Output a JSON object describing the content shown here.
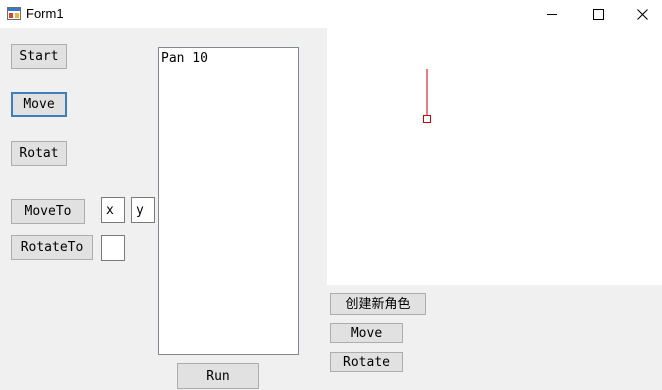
{
  "window": {
    "title": "Form1"
  },
  "left_panel": {
    "start_label": "Start",
    "move_label": "Move",
    "rotat_label": "Rotat",
    "moveto_label": "MoveTo",
    "rotateto_label": "RotateTo",
    "x_input_value": "x",
    "y_input_value": "y",
    "angle_input_value": ""
  },
  "command_list": {
    "items": [
      "Pan 10"
    ]
  },
  "run_label": "Run",
  "right_panel": {
    "create_role_label": "创建新角色",
    "move_label": "Move",
    "rotate_label": "Rotate"
  },
  "colors": {
    "sprite": "#cc0000",
    "focus_border": "#3c7fc1"
  }
}
